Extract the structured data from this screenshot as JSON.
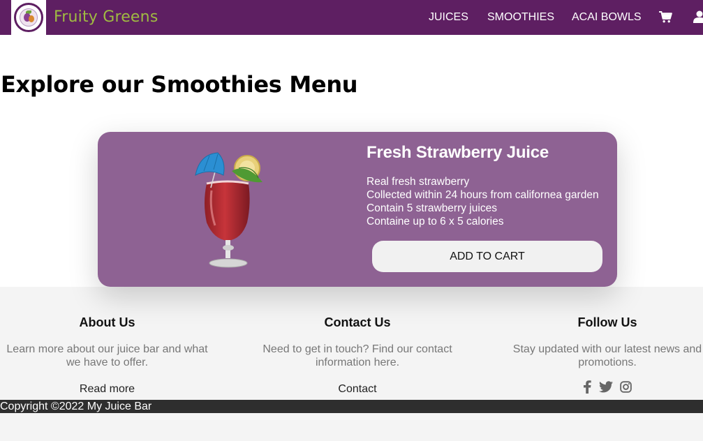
{
  "navbar": {
    "brand": "Fruity Greens",
    "links": [
      "JUICES",
      "SMOOTHIES",
      "ACAI BOWLS"
    ],
    "icons": [
      "cart-icon",
      "user-icon"
    ],
    "background": "#5e1f62",
    "brand_color": "#9fba42"
  },
  "main": {
    "title": "Explore our Smoothies Menu"
  },
  "product": {
    "name": "Fresh Strawberry Juice",
    "description": [
      "Real fresh strawberry",
      "Collected within 24 hours from californea garden",
      "Contain 5 strawberry juices",
      "Containe up to 6 x 5 calories"
    ],
    "button_label": "ADD TO CART",
    "card_color": "#8e6293"
  },
  "footer": {
    "about": {
      "heading": "About Us",
      "text_line1": "Learn more about our juice bar and what",
      "text_line2": "we have to offer.",
      "link": "Read more"
    },
    "contact": {
      "heading": "Contact Us",
      "text_line1": "Need to get in touch? Find our contact",
      "text_line2": "information here.",
      "link": "Contact"
    },
    "follow": {
      "heading": "Follow Us",
      "text_line1": "Stay updated with our latest news and",
      "text_line2": "promotions.",
      "social_icons": [
        "facebook-icon",
        "twitter-icon",
        "instagram-icon"
      ]
    },
    "copyright": "Copyright ©2022 My Juice Bar"
  }
}
